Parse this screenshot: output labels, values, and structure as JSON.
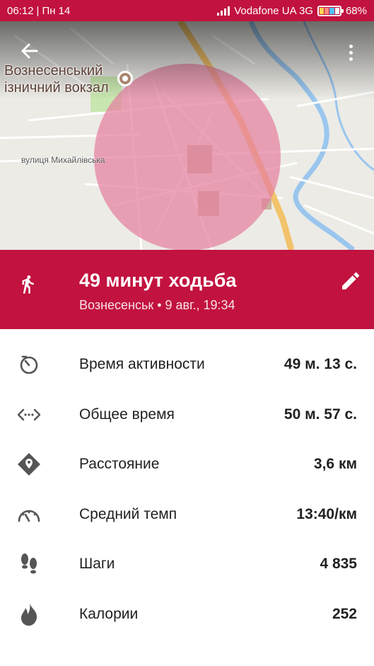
{
  "status_bar": {
    "time": "06:12",
    "day": "Пн 14",
    "carrier": "Vodafone UA 3G",
    "battery": "68%",
    "color": "#c2123f"
  },
  "map": {
    "place_label_line1": "Вознесенський",
    "place_label_line2": "ізничний вокзал",
    "street_label": "вулиця Михайлівська",
    "area_color": "#e57fa0"
  },
  "activity": {
    "icon": "walk-icon",
    "title": "49 минут ходьба",
    "subtitle": "Вознесенськ • 9 авг., 19:34",
    "accent": "#c2123f"
  },
  "stats": [
    {
      "icon": "timer-icon",
      "label": "Время активности",
      "value": "49 м. 13 с."
    },
    {
      "icon": "duration-arrows-icon",
      "label": "Общее время",
      "value": "50 м. 57 с."
    },
    {
      "icon": "location-pin-icon",
      "label": "Расстояние",
      "value": "3,6 км"
    },
    {
      "icon": "speedometer-icon",
      "label": "Средний темп",
      "value": "13:40/км"
    },
    {
      "icon": "footsteps-icon",
      "label": "Шаги",
      "value": "4 835"
    },
    {
      "icon": "flame-icon",
      "label": "Калории",
      "value": "252"
    }
  ]
}
